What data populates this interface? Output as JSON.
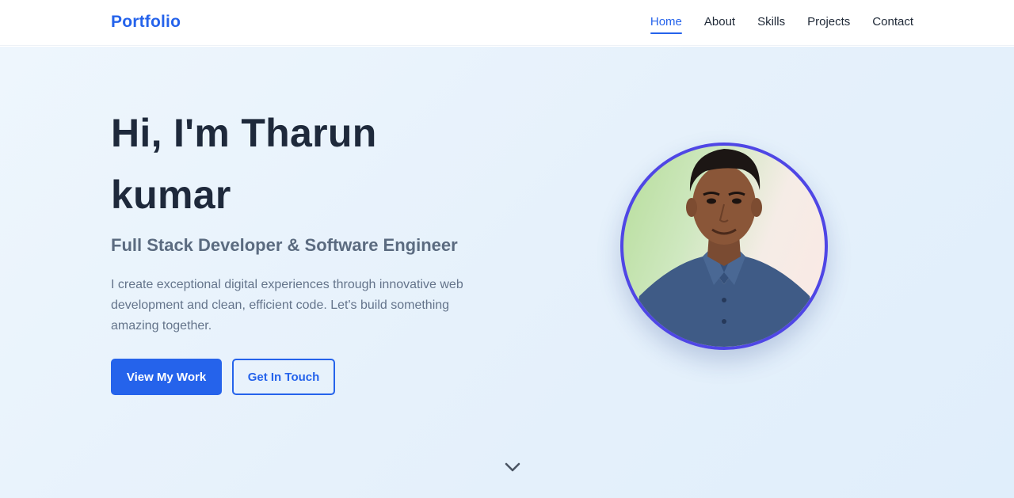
{
  "nav": {
    "brand": "Portfolio",
    "links": [
      {
        "label": "Home",
        "active": true
      },
      {
        "label": "About",
        "active": false
      },
      {
        "label": "Skills",
        "active": false
      },
      {
        "label": "Projects",
        "active": false
      },
      {
        "label": "Contact",
        "active": false
      }
    ]
  },
  "hero": {
    "title": "Hi, I'm Tharun kumar",
    "subtitle": "Full Stack Developer & Software Engineer",
    "description": "I create exceptional digital experiences through innovative web development and clean, efficient code. Let's build something amazing together.",
    "primary_button": "View My Work",
    "secondary_button": "Get In Touch",
    "avatar_icon": "profile-photo",
    "scroll_icon": "chevron-down-icon"
  },
  "colors": {
    "accent": "#2563eb",
    "avatar_ring": "#4f46e5",
    "heading": "#1e293b",
    "muted": "#64748b"
  }
}
